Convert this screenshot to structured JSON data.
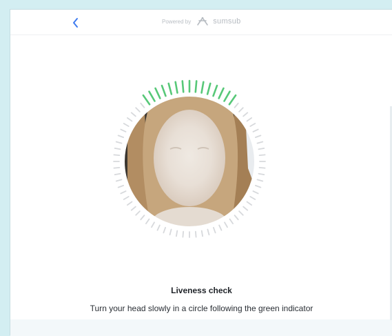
{
  "header": {
    "back_icon": "chevron-left-icon",
    "powered_by": "Powered by",
    "brand": "sumsub",
    "brand_icon": "sumsub-logo-icon"
  },
  "main": {
    "title": "Liveness check",
    "instruction": "Turn your head slowly in a circle following the green indicator"
  },
  "indicator": {
    "progress_color": "#57c878",
    "inactive_color": "#d7d9dc",
    "accent_color": "#3d7bf0"
  }
}
